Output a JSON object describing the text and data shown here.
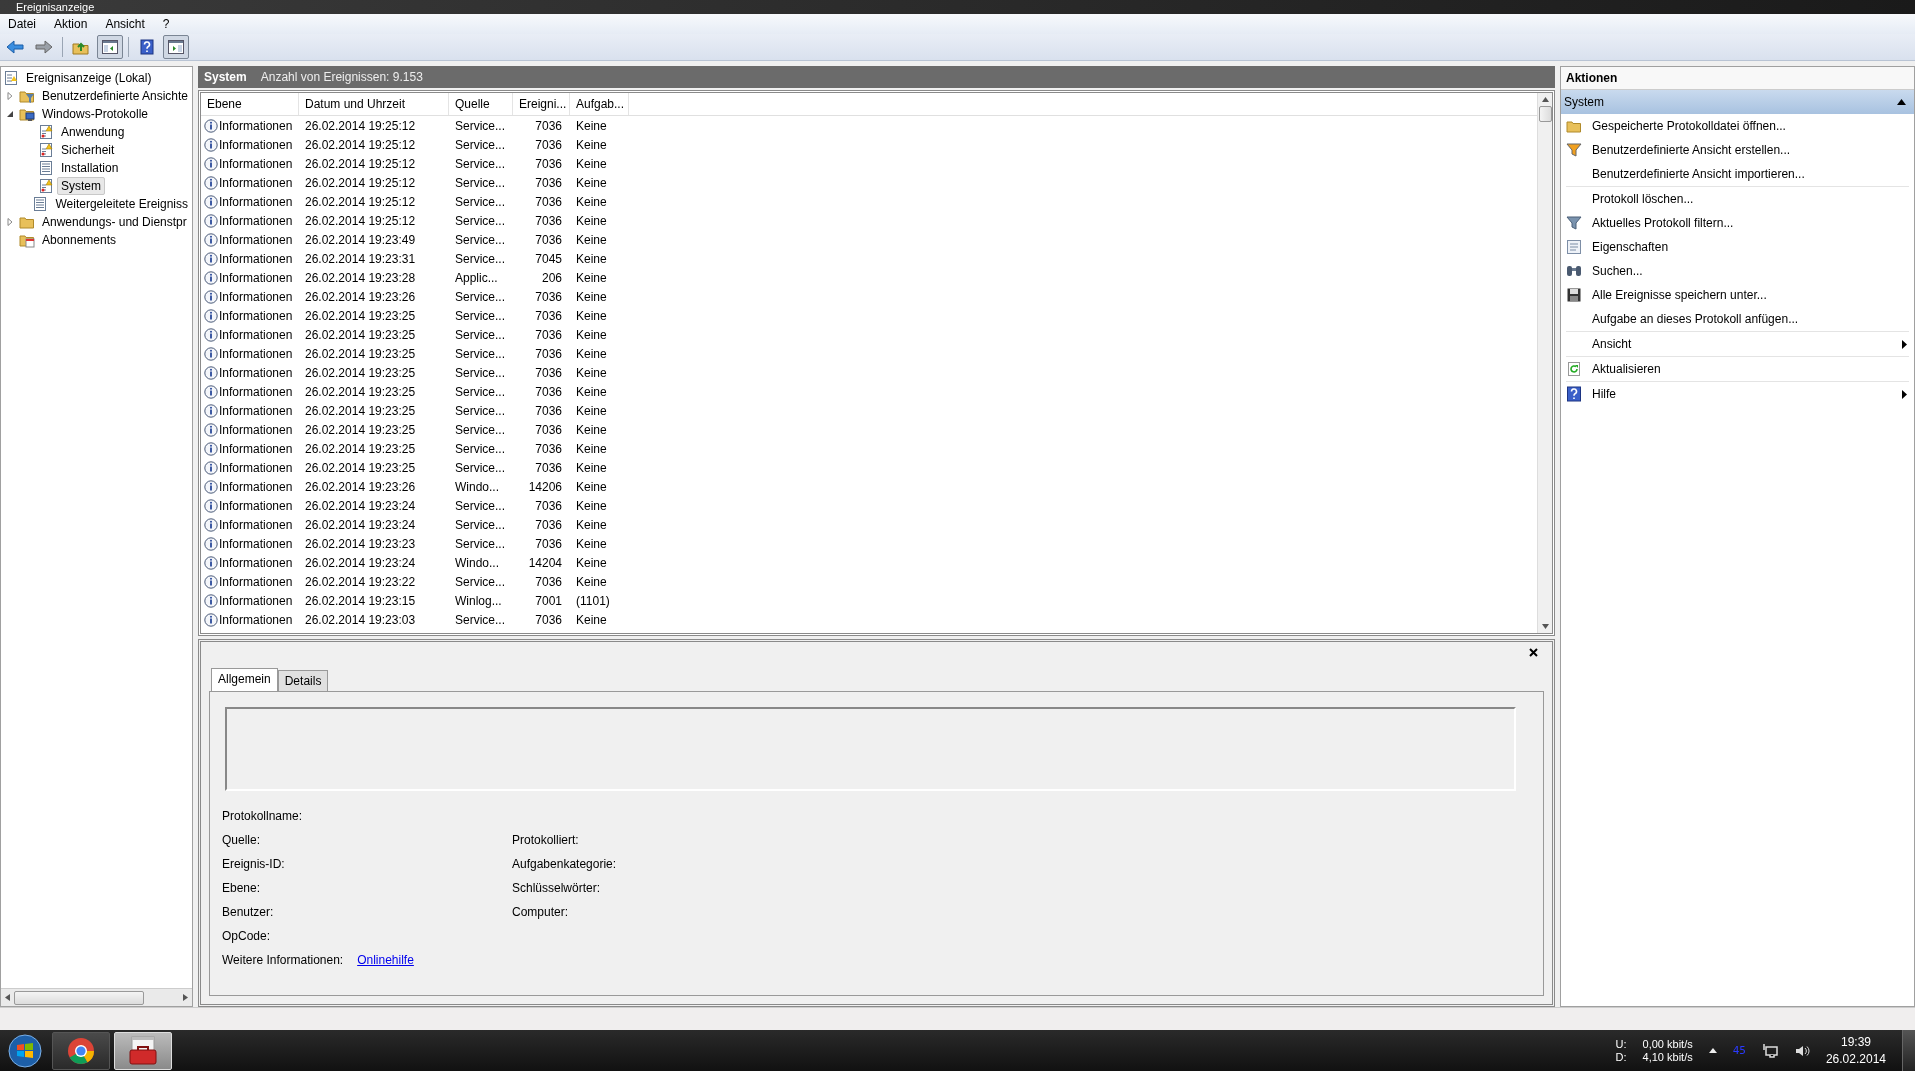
{
  "window": {
    "title": "Ereignisanzeige"
  },
  "menu": [
    "Datei",
    "Aktion",
    "Ansicht",
    "?"
  ],
  "toolbar": [
    {
      "kind": "back",
      "pressed": false
    },
    {
      "kind": "forward",
      "pressed": false
    },
    {
      "kind": "up",
      "pressed": false
    },
    {
      "kind": "tree",
      "pressed": true
    },
    {
      "kind": "help",
      "pressed": false
    },
    {
      "kind": "pane",
      "pressed": true
    }
  ],
  "tree": {
    "label": "Ereignisanzeige (Lokal)",
    "selected": false,
    "children": [
      {
        "label": "Benutzerdefinierte Ansichte",
        "kind": "filterfolder",
        "expanded": false,
        "selected": false
      },
      {
        "label": "Windows-Protokolle",
        "kind": "pcfolder",
        "expanded": true,
        "selected": false,
        "children": [
          {
            "label": "Anwendung",
            "kind": "logwarn",
            "selected": false
          },
          {
            "label": "Sicherheit",
            "kind": "logwarn",
            "selected": false
          },
          {
            "label": "Installation",
            "kind": "log",
            "selected": false
          },
          {
            "label": "System",
            "kind": "logwarn",
            "selected": true
          },
          {
            "label": "Weitergeleitete Ereigniss",
            "kind": "log",
            "selected": false
          }
        ]
      },
      {
        "label": "Anwendungs- und Dienstpr",
        "kind": "folder",
        "expanded": false,
        "selected": false
      },
      {
        "label": "Abonnements",
        "kind": "calfolder",
        "selected": false
      }
    ]
  },
  "log_header": {
    "name": "System",
    "count": "Anzahl von Ereignissen: 9.153"
  },
  "table": {
    "columns": [
      "Ebene",
      "Datum und Uhrzeit",
      "Quelle",
      "Ereigni...",
      "Aufgab..."
    ],
    "rows": [
      [
        "Informationen",
        "26.02.2014 19:25:12",
        "Service...",
        "7036",
        "Keine"
      ],
      [
        "Informationen",
        "26.02.2014 19:25:12",
        "Service...",
        "7036",
        "Keine"
      ],
      [
        "Informationen",
        "26.02.2014 19:25:12",
        "Service...",
        "7036",
        "Keine"
      ],
      [
        "Informationen",
        "26.02.2014 19:25:12",
        "Service...",
        "7036",
        "Keine"
      ],
      [
        "Informationen",
        "26.02.2014 19:25:12",
        "Service...",
        "7036",
        "Keine"
      ],
      [
        "Informationen",
        "26.02.2014 19:25:12",
        "Service...",
        "7036",
        "Keine"
      ],
      [
        "Informationen",
        "26.02.2014 19:23:49",
        "Service...",
        "7036",
        "Keine"
      ],
      [
        "Informationen",
        "26.02.2014 19:23:31",
        "Service...",
        "7045",
        "Keine"
      ],
      [
        "Informationen",
        "26.02.2014 19:23:28",
        "Applic...",
        "206",
        "Keine"
      ],
      [
        "Informationen",
        "26.02.2014 19:23:26",
        "Service...",
        "7036",
        "Keine"
      ],
      [
        "Informationen",
        "26.02.2014 19:23:25",
        "Service...",
        "7036",
        "Keine"
      ],
      [
        "Informationen",
        "26.02.2014 19:23:25",
        "Service...",
        "7036",
        "Keine"
      ],
      [
        "Informationen",
        "26.02.2014 19:23:25",
        "Service...",
        "7036",
        "Keine"
      ],
      [
        "Informationen",
        "26.02.2014 19:23:25",
        "Service...",
        "7036",
        "Keine"
      ],
      [
        "Informationen",
        "26.02.2014 19:23:25",
        "Service...",
        "7036",
        "Keine"
      ],
      [
        "Informationen",
        "26.02.2014 19:23:25",
        "Service...",
        "7036",
        "Keine"
      ],
      [
        "Informationen",
        "26.02.2014 19:23:25",
        "Service...",
        "7036",
        "Keine"
      ],
      [
        "Informationen",
        "26.02.2014 19:23:25",
        "Service...",
        "7036",
        "Keine"
      ],
      [
        "Informationen",
        "26.02.2014 19:23:25",
        "Service...",
        "7036",
        "Keine"
      ],
      [
        "Informationen",
        "26.02.2014 19:23:26",
        "Windo...",
        "14206",
        "Keine"
      ],
      [
        "Informationen",
        "26.02.2014 19:23:24",
        "Service...",
        "7036",
        "Keine"
      ],
      [
        "Informationen",
        "26.02.2014 19:23:24",
        "Service...",
        "7036",
        "Keine"
      ],
      [
        "Informationen",
        "26.02.2014 19:23:23",
        "Service...",
        "7036",
        "Keine"
      ],
      [
        "Informationen",
        "26.02.2014 19:23:24",
        "Windo...",
        "14204",
        "Keine"
      ],
      [
        "Informationen",
        "26.02.2014 19:23:22",
        "Service...",
        "7036",
        "Keine"
      ],
      [
        "Informationen",
        "26.02.2014 19:23:15",
        "Winlog...",
        "7001",
        "(1101)"
      ],
      [
        "Informationen",
        "26.02.2014 19:23:03",
        "Service...",
        "7036",
        "Keine"
      ]
    ]
  },
  "details": {
    "tabs": [
      {
        "label": "Allgemein",
        "selected": true
      },
      {
        "label": "Details",
        "selected": false
      }
    ],
    "fields_left": [
      "Protokollname:",
      "Quelle:",
      "Ereignis-ID:",
      "Ebene:",
      "Benutzer:",
      "OpCode:"
    ],
    "fields_right": [
      "Protokolliert:",
      "Aufgabenkategorie:",
      "Schlüsselwörter:",
      "Computer:"
    ],
    "more_info_label": "Weitere Informationen:",
    "more_info_link": "Onlinehilfe"
  },
  "actions": {
    "title": "Aktionen",
    "section": "System",
    "expanded": true,
    "groups": [
      [
        {
          "label": "Gespeicherte Protokolldatei öffnen...",
          "kind": "folder"
        },
        {
          "label": "Benutzerdefinierte Ansicht erstellen...",
          "kind": "filterorange"
        },
        {
          "label": "Benutzerdefinierte Ansicht importieren..."
        }
      ],
      [
        {
          "label": "Protokoll löschen..."
        },
        {
          "label": "Aktuelles Protokoll filtern...",
          "kind": "filter"
        },
        {
          "label": "Eigenschaften",
          "kind": "props"
        },
        {
          "label": "Suchen...",
          "kind": "binoculars"
        },
        {
          "label": "Alle Ereignisse speichern unter...",
          "kind": "disk"
        },
        {
          "label": "Aufgabe an dieses Protokoll anfügen..."
        }
      ],
      [
        {
          "label": "Ansicht",
          "submenu": true
        }
      ],
      [
        {
          "label": "Aktualisieren",
          "kind": "refresh"
        }
      ],
      [
        {
          "label": "Hilfe",
          "kind": "help",
          "submenu": true
        }
      ]
    ]
  },
  "taskbar": {
    "apps": [
      {
        "kind": "browser",
        "active": false
      },
      {
        "kind": "toolbox",
        "active": true
      }
    ],
    "net_labels": [
      "U:",
      "D:"
    ],
    "net_values": [
      "0,00 kbit/s",
      "4,10 kbit/s"
    ],
    "tray_badge": "45",
    "time": "19:39",
    "date": "26.02.2014"
  }
}
